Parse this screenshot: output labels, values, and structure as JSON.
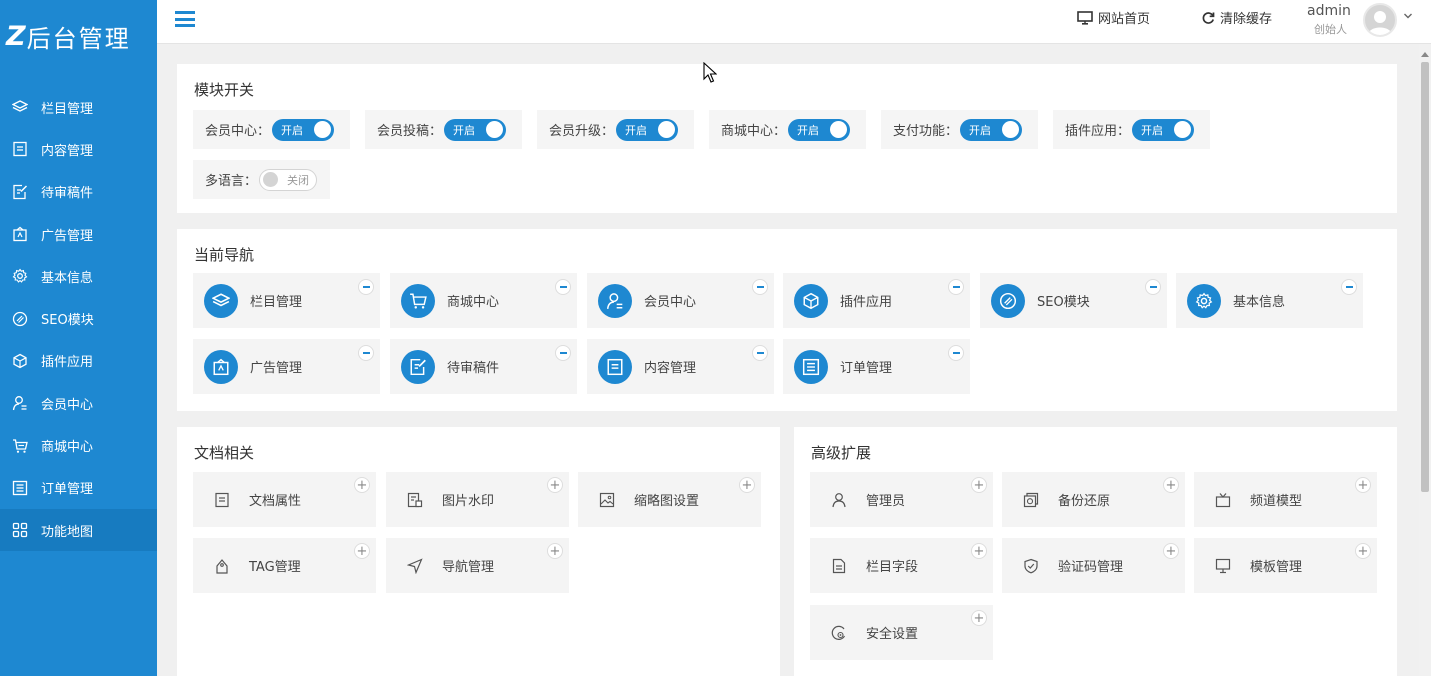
{
  "sidebar": {
    "logo_mark": "Z",
    "logo_text": "后台管理",
    "items": [
      {
        "label": "栏目管理",
        "icon": "layers-icon"
      },
      {
        "label": "内容管理",
        "icon": "document-icon"
      },
      {
        "label": "待审稿件",
        "icon": "edit-doc-icon"
      },
      {
        "label": "广告管理",
        "icon": "ad-icon"
      },
      {
        "label": "基本信息",
        "icon": "gear-icon"
      },
      {
        "label": "SEO模块",
        "icon": "seo-icon"
      },
      {
        "label": "插件应用",
        "icon": "cube-icon"
      },
      {
        "label": "会员中心",
        "icon": "user-icon"
      },
      {
        "label": "商城中心",
        "icon": "cart-icon"
      },
      {
        "label": "订单管理",
        "icon": "list-icon"
      },
      {
        "label": "功能地图",
        "icon": "grid-icon"
      }
    ],
    "active_index": 10
  },
  "topbar": {
    "site_home": "网站首页",
    "clear_cache": "清除缓存",
    "user_name": "admin",
    "user_role": "创始人"
  },
  "modules": {
    "title": "模块开关",
    "switches": [
      {
        "label": "会员中心：",
        "state": "开启",
        "on": true
      },
      {
        "label": "会员投稿：",
        "state": "开启",
        "on": true
      },
      {
        "label": "会员升级：",
        "state": "开启",
        "on": true
      },
      {
        "label": "商城中心：",
        "state": "开启",
        "on": true
      },
      {
        "label": "支付功能：",
        "state": "开启",
        "on": true
      },
      {
        "label": "插件应用：",
        "state": "开启",
        "on": true
      },
      {
        "label": "多语言：",
        "state": "关闭",
        "on": false
      }
    ]
  },
  "nav": {
    "title": "当前导航",
    "items": [
      {
        "label": "栏目管理",
        "icon": "layers-icon"
      },
      {
        "label": "商城中心",
        "icon": "cart-icon"
      },
      {
        "label": "会员中心",
        "icon": "user-icon"
      },
      {
        "label": "插件应用",
        "icon": "cube-icon"
      },
      {
        "label": "SEO模块",
        "icon": "seo-icon"
      },
      {
        "label": "基本信息",
        "icon": "gear-icon"
      },
      {
        "label": "广告管理",
        "icon": "ad-icon"
      },
      {
        "label": "待审稿件",
        "icon": "edit-doc-icon"
      },
      {
        "label": "内容管理",
        "icon": "document-icon"
      },
      {
        "label": "订单管理",
        "icon": "list-icon"
      }
    ]
  },
  "docs": {
    "title": "文档相关",
    "items": [
      {
        "label": "文档属性",
        "icon": "doc-attr-icon"
      },
      {
        "label": "图片水印",
        "icon": "watermark-icon"
      },
      {
        "label": "缩略图设置",
        "icon": "image-icon"
      },
      {
        "label": "TAG管理",
        "icon": "tag-icon"
      },
      {
        "label": "导航管理",
        "icon": "navigate-icon"
      }
    ]
  },
  "advanced": {
    "title": "高级扩展",
    "items": [
      {
        "label": "管理员",
        "icon": "admin-user-icon"
      },
      {
        "label": "备份还原",
        "icon": "backup-icon"
      },
      {
        "label": "频道模型",
        "icon": "tv-icon"
      },
      {
        "label": "栏目字段",
        "icon": "field-icon"
      },
      {
        "label": "验证码管理",
        "icon": "shield-check-icon"
      },
      {
        "label": "模板管理",
        "icon": "monitor-icon"
      },
      {
        "label": "安全设置",
        "icon": "security-icon"
      }
    ]
  },
  "colors": {
    "accent": "#1e88d1",
    "sidebar_bg": "#1e88d1",
    "active_bg": "#177bc0"
  }
}
